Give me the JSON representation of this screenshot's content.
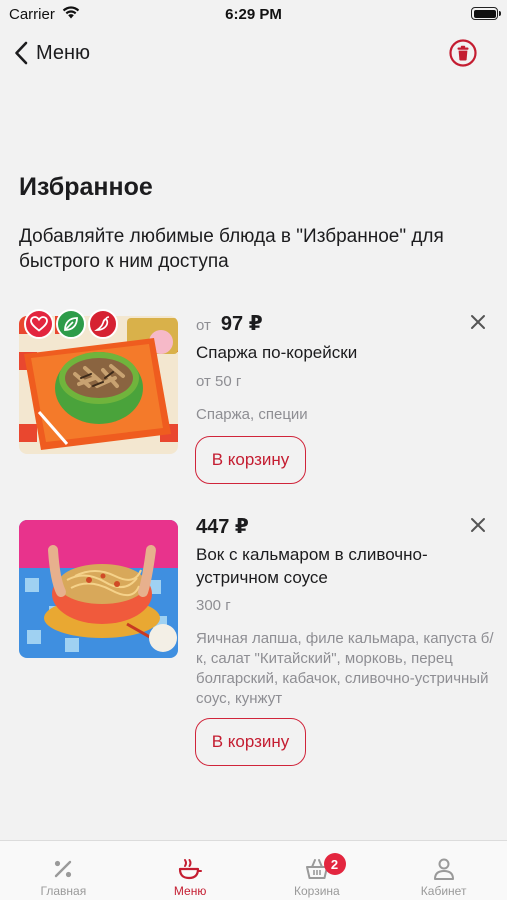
{
  "status_bar": {
    "carrier": "Carrier",
    "time": "6:29 PM"
  },
  "nav": {
    "back_label": "Меню"
  },
  "page": {
    "title": "Избранное",
    "description": "Добавляйте любимые блюда в \"Избранное\" для быстрого к ним доступа"
  },
  "items": [
    {
      "price_prefix": "от",
      "price": "97 ₽",
      "name": "Спаржа по-корейски",
      "weight": "от 50 г",
      "ingredients": "Спаржа, специи",
      "cart_label": "В корзину",
      "badges": [
        "heart-icon",
        "leaf-icon",
        "chili-icon"
      ]
    },
    {
      "price": "447 ₽",
      "name": "Вок с кальмаром в сливочно-устричном соусе",
      "weight": "300 г",
      "ingredients": "Яичная лапша, филе кальмара, капуста б/к, салат \"Китайский\", морковь, перец болгарский, кабачок, сливочно-устричный соус, кунжут",
      "cart_label": "В корзину"
    }
  ],
  "tabs": [
    {
      "label": "Главная",
      "icon": "percent-icon"
    },
    {
      "label": "Меню",
      "icon": "menu-bowl-icon",
      "active": true
    },
    {
      "label": "Корзина",
      "icon": "basket-icon",
      "badge": "2"
    },
    {
      "label": "Кабинет",
      "icon": "user-icon"
    }
  ],
  "colors": {
    "accent": "#c41d31",
    "badge": "#e3263f",
    "background": "#f2f2f2"
  }
}
